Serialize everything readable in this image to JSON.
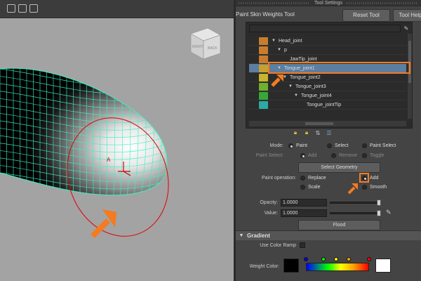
{
  "panel": {
    "title": "Tool Settings",
    "tool_name": "Paint Skin Weights Tool",
    "reset_button": "Reset Tool",
    "help_button": "Tool Help"
  },
  "influences": [
    {
      "name": "Head_joint",
      "color": "#c87d2e"
    },
    {
      "name": "p",
      "color": "#c87d2e"
    },
    {
      "name": "JawTip_joint",
      "color": "#c87d2e"
    },
    {
      "name": "Tongue_joint1",
      "color": "#c8a02e"
    },
    {
      "name": "Tongue_joint2",
      "color": "#c8b42e"
    },
    {
      "name": "Tongue_joint3",
      "color": "#6fb12e"
    },
    {
      "name": "Tongue_joint4",
      "color": "#3aa53a"
    },
    {
      "name": "Tongue_jointTip",
      "color": "#2eaaa5"
    }
  ],
  "settings": {
    "mode_label": "Mode:",
    "mode_options": [
      "Paint",
      "Select",
      "Paint Select"
    ],
    "paint_select_label": "Paint Select:",
    "paint_select_options": [
      "Add",
      "Remove",
      "Toggle"
    ],
    "select_geometry": "Select Geometry",
    "paint_operation_label": "Paint operation:",
    "paint_operation_options": [
      "Replace",
      "Add",
      "Scale",
      "Smooth"
    ],
    "opacity_label": "Opacity:",
    "opacity_value": "1.0000",
    "opacity_level": 1.0,
    "value_label": "Value:",
    "value_value": "1.0000",
    "value_level": 1.0,
    "flood": "Flood"
  },
  "gradient": {
    "section_title": "Gradient",
    "use_color_ramp": "Use Color Ramp",
    "weight_color_label": "Weight Color:"
  },
  "viewport": {
    "manipulator_label": "A",
    "viewcube_faces": [
      "RIGHT",
      "BACK"
    ]
  },
  "colors": {
    "highlight": "#f47b20",
    "wireframe": "#3ef0c0",
    "brush": "#e00000",
    "selection": "#5b7ea1"
  }
}
